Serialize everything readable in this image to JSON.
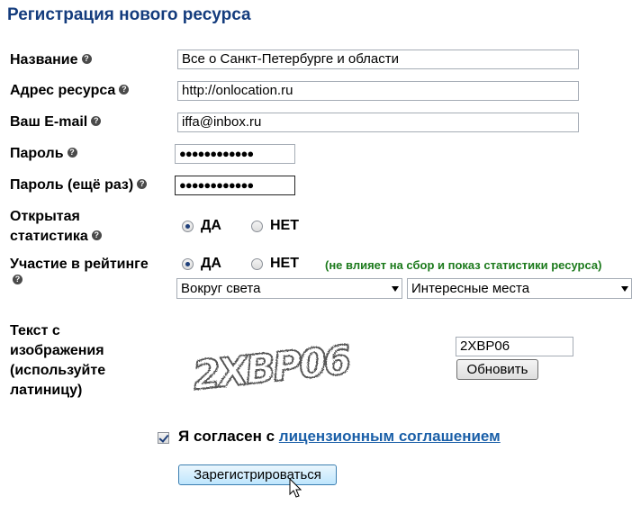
{
  "title": "Регистрация нового ресурса",
  "labels": {
    "name": "Название",
    "url": "Адрес ресурса",
    "email": "Ваш E-mail",
    "password": "Пароль",
    "password2": "Пароль (ещё раз)",
    "stats_line1": "Открытая",
    "stats_line2": "статистика",
    "rating": "Участие в рейтинге",
    "captcha_line1": "Текст с",
    "captcha_line2": "изображения",
    "captcha_line3": "(используйте",
    "captcha_line4": "латиницу)"
  },
  "help_glyph": "?",
  "fields": {
    "name": "Все о Санкт-Петербурге и области",
    "url": "http://onlocation.ru",
    "email": "iffa@inbox.ru",
    "password": "●●●●●●●●●●●●",
    "password2": "●●●●●●●●●●●●",
    "captcha": "2XBP06"
  },
  "radio": {
    "yes": "ДА",
    "no": "НЕТ",
    "stats_selected": "yes",
    "rating_selected": "yes"
  },
  "rating_note": "(не влияет на сбор и показ статистики ресурса)",
  "selects": {
    "category1": "Вокруг света",
    "category2": "Интересные места"
  },
  "captcha_image_text": "2XBP06",
  "buttons": {
    "refresh": "Обновить",
    "register": "Зарегистрироваться"
  },
  "agree": {
    "checked": true,
    "text": "Я согласен с ",
    "link": "лицензионным соглашением"
  }
}
